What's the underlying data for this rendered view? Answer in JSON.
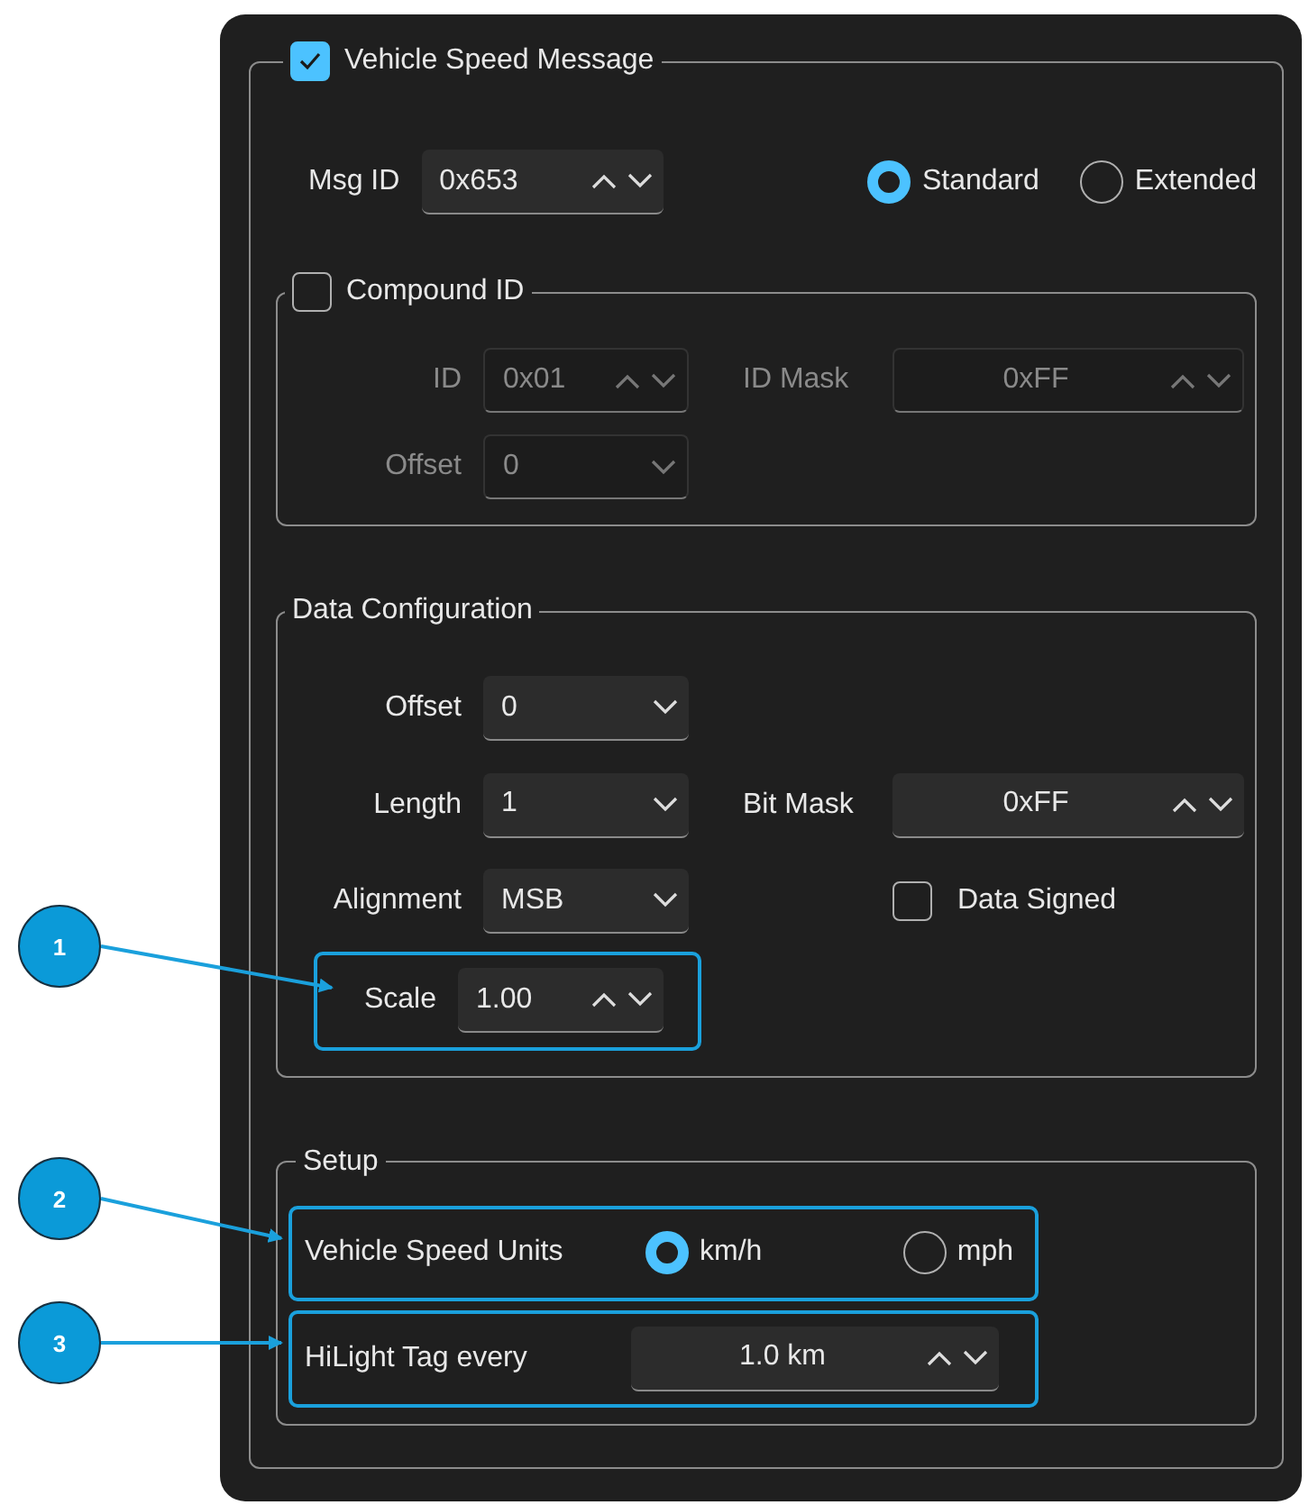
{
  "message_group": {
    "title": "Vehicle Speed Message",
    "checked": true,
    "msg_id": {
      "label": "Msg ID",
      "value": "0x653"
    },
    "id_types": [
      {
        "label": "Standard",
        "selected": true
      },
      {
        "label": "Extended",
        "selected": false
      }
    ],
    "compound_id": {
      "title": "Compound ID",
      "checked": false,
      "id": {
        "label": "ID",
        "value": "0x01"
      },
      "id_mask": {
        "label": "ID Mask",
        "value": "0xFF"
      },
      "offset": {
        "label": "Offset",
        "value": "0"
      }
    },
    "data_configuration": {
      "title": "Data Configuration",
      "offset": {
        "label": "Offset",
        "value": "0"
      },
      "length": {
        "label": "Length",
        "value": "1"
      },
      "bit_mask": {
        "label": "Bit Mask",
        "value": "0xFF"
      },
      "alignment": {
        "label": "Alignment",
        "value": "MSB"
      },
      "data_signed": {
        "label": "Data Signed",
        "checked": false
      },
      "scale": {
        "label": "Scale",
        "value": "1.00",
        "callout": "1"
      }
    },
    "setup": {
      "title": "Setup",
      "units": {
        "label": "Vehicle Speed Units",
        "callout": "2",
        "options": [
          {
            "label": "km/h",
            "selected": true
          },
          {
            "label": "mph",
            "selected": false
          }
        ]
      },
      "hilight": {
        "label": "HiLight Tag every",
        "value": "1.0 km",
        "callout": "3"
      }
    }
  }
}
